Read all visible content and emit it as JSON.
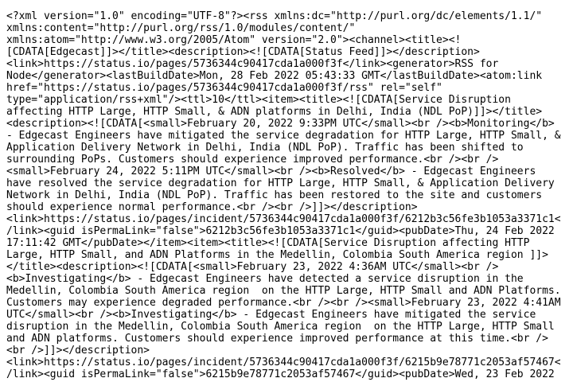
{
  "document": {
    "lines": [
      "<?xml version=\"1.0\" encoding=\"UTF-8\"?><rss xmlns:dc=\"http://purl.org/dc/elements/1.1/\"",
      "xmlns:content=\"http://purl.org/rss/1.0/modules/content/\"",
      "xmlns:atom=\"http://www.w3.org/2005/Atom\" version=\"2.0\"><channel><title><!",
      "[CDATA[Edgecast]]></title><description><![CDATA[Status Feed]]></description>",
      "<link>https://status.io/pages/5736344c90417cda1a000f3f</link><generator>RSS for",
      "Node</generator><lastBuildDate>Mon, 28 Feb 2022 05:43:33 GMT</lastBuildDate><atom:link",
      "href=\"https://status.io/pages/5736344c90417cda1a000f3f/rss\" rel=\"self\"",
      "type=\"application/rss+xml\"/><ttl>10</ttl><item><title><![CDATA[Service Disruption",
      "affecting HTTP Large, HTTP Small, & ADN platforms in Delhi, India (NDL PoP)]]></title>",
      "<description><![CDATA[<small>February 20, 2022 9:33PM UTC</small><br /><b>Monitoring</b>",
      "- Edgecast Engineers have mitigated the service degradation for HTTP Large, HTTP Small, &",
      "Application Delivery Network in Delhi, India (NDL PoP). Traffic has been shifted to",
      "surrounding PoPs. Customers should experience improved performance.<br /><br />",
      "<small>February 24, 2022 5:11PM UTC</small><br /><b>Resolved</b> - Edgecast Engineers",
      "have resolved the service degradation for HTTP Large, HTTP Small, & Application Delivery",
      "Network in Delhi, India (NDL PoP). Traffic has been restored to the site and customers",
      "should experience normal performance.<br /><br />]]></description>",
      "<link>https://status.io/pages/incident/5736344c90417cda1a000f3f/6212b3c56fe3b1053a3371c1<",
      "/link><guid isPermaLink=\"false\">6212b3c56fe3b1053a3371c1</guid><pubDate>Thu, 24 Feb 2022",
      "17:11:42 GMT</pubDate></item><item><title><![CDATA[Service Disruption affecting HTTP",
      "Large, HTTP Small, and ADN Platforms in the Medellin, Colombia South America region ]]>",
      "</title><description><![CDATA[<small>February 23, 2022 4:36AM UTC</small><br />",
      "<b>Investigating</b> - Edgecast Engineers have detected a service disruption in the",
      "Medellin, Colombia South America region  on the HTTP Large, HTTP Small and ADN Platforms.",
      "Customers may experience degraded performance.<br /><br /><small>February 23, 2022 4:41AM",
      "UTC</small><br /><b>Investigating</b> - Edgecast Engineers have mitigated the service",
      "disruption in the Medellin, Colombia South America region  on the HTTP Large, HTTP Small",
      "and ADN platforms. Customers should experience improved performance at this time.<br />",
      "<br />]]></description>",
      "<link>https://status.io/pages/incident/5736344c90417cda1a000f3f/6215b9e78771c2053af57467<",
      "/link><guid isPermaLink=\"false\">6215b9e78771c2053af57467</guid><pubDate>Wed, 23 Feb 2022"
    ]
  }
}
